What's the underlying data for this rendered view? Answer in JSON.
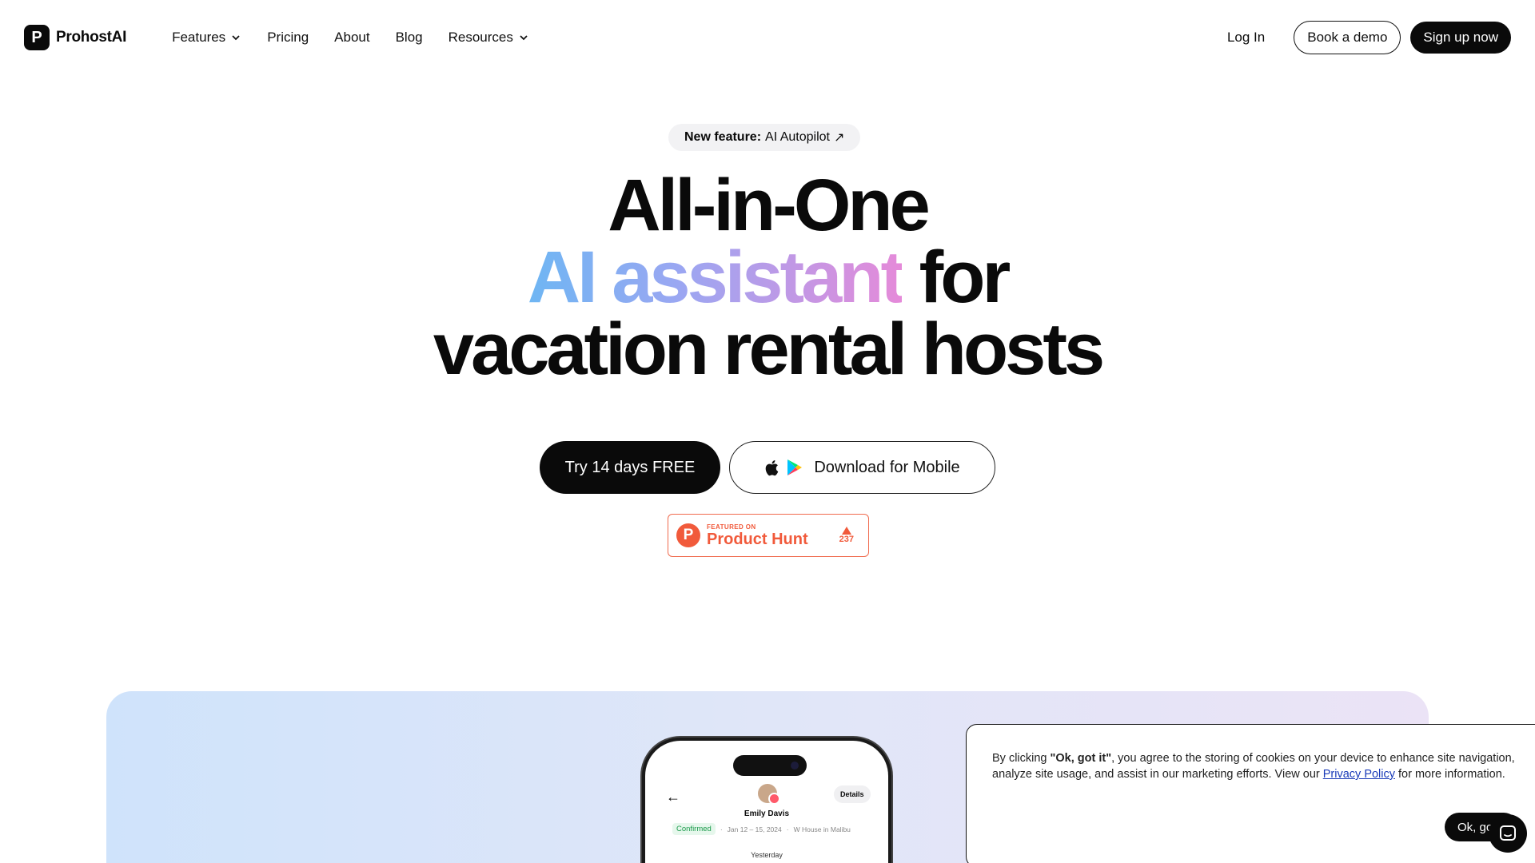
{
  "nav": {
    "logo_letter": "P",
    "logo_text": "ProhostAI",
    "menu": [
      {
        "label": "Features",
        "has_dropdown": true
      },
      {
        "label": "Pricing",
        "has_dropdown": false
      },
      {
        "label": "About",
        "has_dropdown": false
      },
      {
        "label": "Blog",
        "has_dropdown": false
      },
      {
        "label": "Resources",
        "has_dropdown": true
      }
    ],
    "login": "Log In",
    "book_demo": "Book a demo",
    "signup": "Sign up now"
  },
  "hero": {
    "pill_bold": "New feature:",
    "pill_text": "AI Autopilot",
    "pill_arrow": "↗",
    "line1": "All-in-One",
    "line2_grad": "AI assistant",
    "line2_rest": " for",
    "line3": "vacation rental hosts",
    "cta_try": "Try 14 days FREE",
    "cta_mobile": "Download for Mobile"
  },
  "product_hunt": {
    "logo_letter": "P",
    "featured": "FEATURED ON",
    "name": "Product Hunt",
    "votes": "237",
    "color": "#f15a3b"
  },
  "phone": {
    "details": "Details",
    "guest": "Emily Davis",
    "status": "Confirmed",
    "dates": "Jan 12 – 15, 2024",
    "property": "W House in Malibu",
    "day": "Yesterday"
  },
  "cookie": {
    "pre": "By clicking ",
    "bold": "\"Ok, got it\"",
    "mid": ", you agree to the storing of cookies on your device to enhance site navigation, analyze site usage, and assist in our marketing efforts. View our ",
    "link": "Privacy Policy",
    "post": " for more information.",
    "button": "Ok, got it"
  },
  "icons": [
    "chevron-down-icon",
    "arrow-up-right-icon",
    "apple-icon",
    "google-play-icon",
    "upvote-triangle-icon",
    "back-arrow-icon",
    "chat-icon"
  ]
}
